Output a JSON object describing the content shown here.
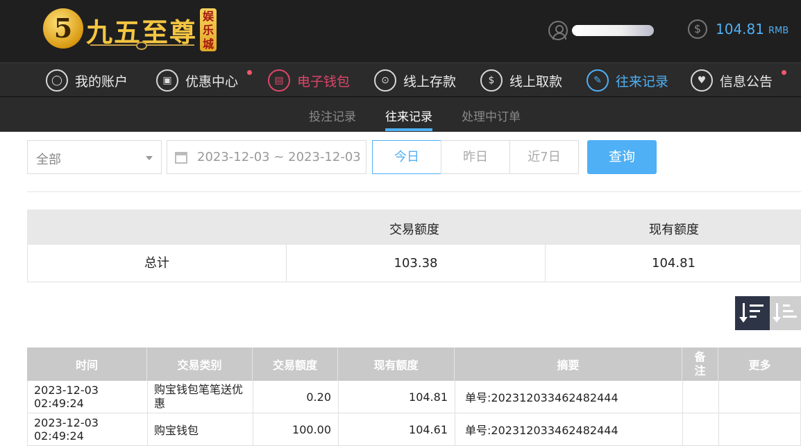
{
  "brand": {
    "logo_number": "5",
    "name": "九五至尊",
    "badge": "娱乐城"
  },
  "user": {
    "balance": "104.81",
    "currency": "RMB"
  },
  "nav": [
    {
      "label": "我的账户",
      "icon": "user-icon"
    },
    {
      "label": "优惠中心",
      "icon": "gift-icon"
    },
    {
      "label": "电子钱包",
      "icon": "wallet-icon"
    },
    {
      "label": "线上存款",
      "icon": "deposit-icon"
    },
    {
      "label": "线上取款",
      "icon": "withdraw-icon"
    },
    {
      "label": "往来记录",
      "icon": "records-icon"
    },
    {
      "label": "信息公告",
      "icon": "bell-icon"
    }
  ],
  "subnav": [
    "投注记录",
    "往来记录",
    "处理中订单"
  ],
  "filter": {
    "type_value": "全部",
    "date_range": "2023-12-03 ~ 2023-12-03",
    "quick": [
      "今日",
      "昨日",
      "近7日"
    ],
    "query_label": "查询"
  },
  "summary": {
    "headers": [
      "交易额度",
      "现有额度"
    ],
    "label": "总计",
    "trade_amount": "103.38",
    "current_amount": "104.81"
  },
  "table": {
    "headers": [
      "时间",
      "交易类别",
      "交易额度",
      "现有额度",
      "摘要",
      "备注",
      "更多"
    ],
    "rows": [
      {
        "time": "2023-12-03 02:49:24",
        "type": "购宝钱包笔笔送优惠",
        "amount": "0.20",
        "balance": "104.81",
        "summary": "单号:202312033462482444",
        "note": "",
        "more": ""
      },
      {
        "time": "2023-12-03 02:49:24",
        "type": "购宝钱包",
        "amount": "100.00",
        "balance": "104.61",
        "summary": "单号:202312033462482444",
        "note": "",
        "more": ""
      }
    ]
  },
  "colors": {
    "accent": "#4fb0f5",
    "active_red": "#e0456a",
    "header_bg": "#1f1f1f",
    "nav_bg": "#2b2b2b"
  }
}
